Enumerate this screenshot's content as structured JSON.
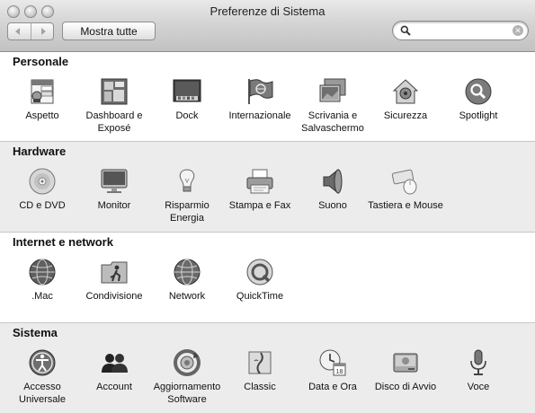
{
  "window": {
    "title": "Preferenze di Sistema"
  },
  "toolbar": {
    "back_icon": "left-arrow-icon",
    "forward_icon": "right-arrow-icon",
    "show_all_label": "Mostra tutte",
    "search_value": "",
    "search_placeholder": ""
  },
  "sections": [
    {
      "title": "Personale",
      "items": [
        {
          "label": "Aspetto",
          "icon": "appearance-icon"
        },
        {
          "label": "Dashboard e Exposé",
          "icon": "dashboard-expose-icon"
        },
        {
          "label": "Dock",
          "icon": "dock-icon"
        },
        {
          "label": "Internazionale",
          "icon": "flag-icon"
        },
        {
          "label": "Scrivania e Salvaschermo",
          "icon": "desktop-screensaver-icon"
        },
        {
          "label": "Sicurezza",
          "icon": "house-lock-icon"
        },
        {
          "label": "Spotlight",
          "icon": "spotlight-icon"
        }
      ]
    },
    {
      "title": "Hardware",
      "items": [
        {
          "label": "CD e DVD",
          "icon": "disc-icon"
        },
        {
          "label": "Monitor",
          "icon": "monitor-icon"
        },
        {
          "label": "Risparmio Energia",
          "icon": "lightbulb-icon"
        },
        {
          "label": "Stampa e Fax",
          "icon": "printer-icon"
        },
        {
          "label": "Suono",
          "icon": "speaker-icon"
        },
        {
          "label": "Tastiera e Mouse",
          "icon": "keyboard-mouse-icon"
        }
      ]
    },
    {
      "title": "Internet e network",
      "items": [
        {
          "label": ".Mac",
          "icon": "globe-icon"
        },
        {
          "label": "Condivisione",
          "icon": "sharing-folder-icon"
        },
        {
          "label": "Network",
          "icon": "network-globe-icon"
        },
        {
          "label": "QuickTime",
          "icon": "quicktime-icon"
        }
      ]
    },
    {
      "title": "Sistema",
      "items": [
        {
          "label": "Accesso Universale",
          "icon": "accessibility-icon"
        },
        {
          "label": "Account",
          "icon": "accounts-icon"
        },
        {
          "label": "Aggiornamento Software",
          "icon": "software-update-icon"
        },
        {
          "label": "Classic",
          "icon": "classic-icon"
        },
        {
          "label": "Data e Ora",
          "icon": "clock-calendar-icon"
        },
        {
          "label": "Disco di Avvio",
          "icon": "hard-disk-icon"
        },
        {
          "label": "Voce",
          "icon": "microphone-icon"
        }
      ]
    }
  ]
}
